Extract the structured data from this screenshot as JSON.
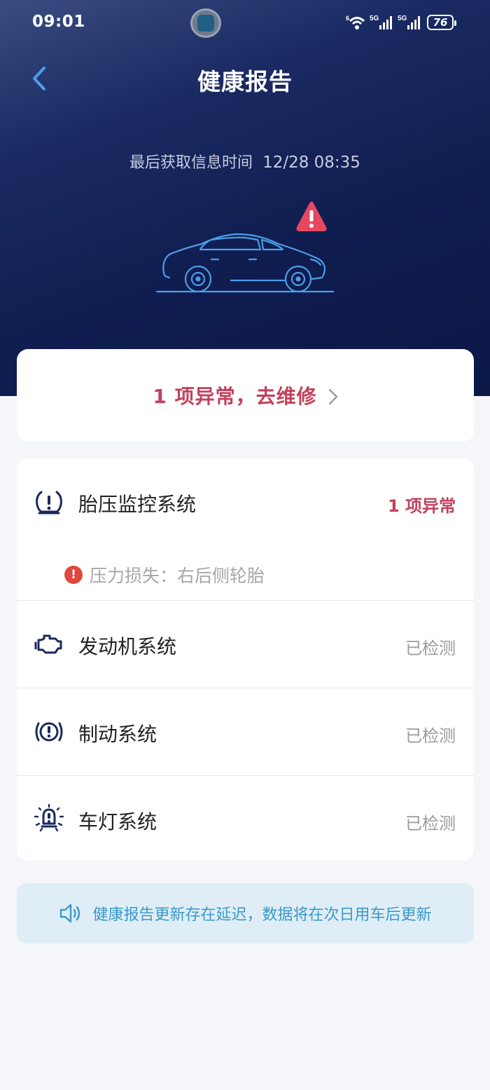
{
  "status_bar": {
    "time": "09:01",
    "battery": "76",
    "network_1": "5G",
    "network_2": "5G",
    "wifi_badge": "6"
  },
  "header": {
    "title": "健康报告",
    "back_icon": "chevron-left-icon"
  },
  "info": {
    "update_label": "最后获取信息时间",
    "update_value": "12/28 08:35"
  },
  "summary": {
    "alert_icon": "warning-triangle-icon",
    "repair_text": "1 项异常，去维修",
    "chevron_icon": "chevron-right-icon"
  },
  "systems": [
    {
      "icon": "tire-pressure-icon",
      "name": "胎压监控系统",
      "status": "1 项异常",
      "issues": [
        {
          "icon": "error-icon",
          "text": "压力损失：右后侧轮胎"
        }
      ]
    },
    {
      "icon": "engine-icon",
      "name": "发动机系统",
      "status": "已检测"
    },
    {
      "icon": "brake-icon",
      "name": "制动系统",
      "status": "已检测"
    },
    {
      "icon": "car-light-icon",
      "name": "车灯系统",
      "status": "已检测"
    }
  ],
  "notice": {
    "icon": "speaker-icon",
    "text": "健康报告更新存在延迟，数据将在次日用车后更新"
  },
  "colors": {
    "header_bg": "#101d50",
    "warning": "#c2415c",
    "alert_triangle": "#e8475f",
    "notice_bg": "#dfeef6",
    "notice_text": "#3a98c9",
    "icon_dark": "#1a2a5c",
    "accent_blue": "#4b9fe8"
  }
}
